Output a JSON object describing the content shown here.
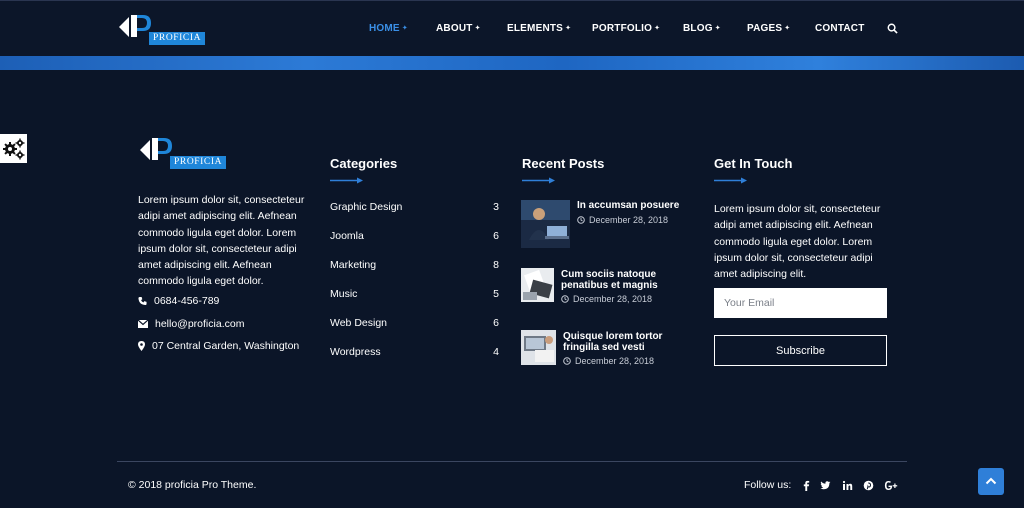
{
  "brand": {
    "name": "PROFICIA"
  },
  "nav": {
    "items": [
      {
        "label": "HOME",
        "arrow": "✦"
      },
      {
        "label": "ABOUT",
        "arrow": "✦"
      },
      {
        "label": "ELEMENTS",
        "arrow": "✦"
      },
      {
        "label": "PORTFOLIO",
        "arrow": "✦"
      },
      {
        "label": "BLOG",
        "arrow": "✦"
      },
      {
        "label": "PAGES",
        "arrow": "✦"
      },
      {
        "label": "CONTACT"
      }
    ],
    "active_color": "#3a8fe6"
  },
  "about": {
    "text": "Lorem ipsum dolor sit, consecteteur adipi amet adipiscing elit. Aefnean commodo ligula eget dolor. Lorem ipsum dolor sit, consecteteur adipi amet adipiscing elit. Aefnean commodo ligula eget dolor.",
    "phone": "0684-456-789",
    "email": "hello@proficia.com",
    "address": "07 Central Garden, Washington"
  },
  "categories": {
    "title": "Categories",
    "items": [
      {
        "name": "Graphic Design",
        "count": "3"
      },
      {
        "name": "Joomla",
        "count": "6"
      },
      {
        "name": "Marketing",
        "count": "8"
      },
      {
        "name": "Music",
        "count": "5"
      },
      {
        "name": "Web Design",
        "count": "6"
      },
      {
        "name": "Wordpress",
        "count": "4"
      }
    ]
  },
  "recent_posts": {
    "title": "Recent Posts",
    "items": [
      {
        "title_line1": "In accumsan posuere",
        "title_line2": "",
        "date": "December 28, 2018"
      },
      {
        "title_line1": "Cum sociis natoque",
        "title_line2": "penatibus et magnis",
        "date": "December 28, 2018"
      },
      {
        "title_line1": "Quisque lorem tortor",
        "title_line2": "fringilla sed vesti",
        "date": "December 28, 2018"
      }
    ]
  },
  "get_in_touch": {
    "title": "Get In Touch",
    "text": "Lorem ipsum dolor sit, consecteteur adipi amet adipiscing elit. Aefnean commodo ligula eget dolor. Lorem ipsum dolor sit, consecteteur adipi amet adipiscing elit.",
    "email_placeholder": "Your Email",
    "subscribe_label": "Subscribe"
  },
  "footer": {
    "copyright": "© 2018 proficia Pro Theme.",
    "follow_label": "Follow us:",
    "social_icons": [
      "facebook-icon",
      "twitter-icon",
      "linkedin-icon",
      "pinterest-icon",
      "google-plus-icon"
    ]
  },
  "colors": {
    "background": "#0b1528",
    "accent": "#2f7fd8"
  }
}
